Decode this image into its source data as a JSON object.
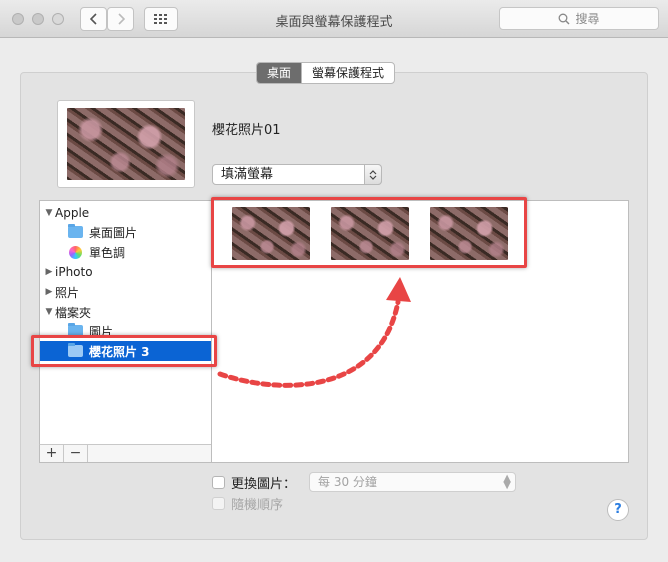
{
  "window": {
    "title": "桌面與螢幕保護程式",
    "search_placeholder": "搜尋"
  },
  "tabs": [
    {
      "label": "桌面",
      "active": true
    },
    {
      "label": "螢幕保護程式",
      "active": false
    }
  ],
  "current": {
    "photo_name": "櫻花照片01",
    "fit_option": "填滿螢幕"
  },
  "sidebar": {
    "items": [
      {
        "label": "Apple",
        "expanded": true
      },
      {
        "label": "桌面圖片",
        "icon": "folder-icon"
      },
      {
        "label": "單色調",
        "icon": "color-wheel-icon"
      },
      {
        "label": "iPhoto",
        "expanded": false
      },
      {
        "label": "照片",
        "expanded": false
      },
      {
        "label": "檔案夾",
        "expanded": true
      },
      {
        "label": "圖片",
        "icon": "folder-icon"
      },
      {
        "label": "櫻花照片 3",
        "icon": "folder-icon",
        "selected": true
      }
    ],
    "add_label": "+",
    "remove_label": "−"
  },
  "options": {
    "change_picture": "更換圖片：",
    "interval": "每 30 分鐘",
    "random_order": "隨機順序"
  },
  "help_label": "?",
  "colors": {
    "selection": "#0b64d4",
    "annotation": "#e84545"
  }
}
